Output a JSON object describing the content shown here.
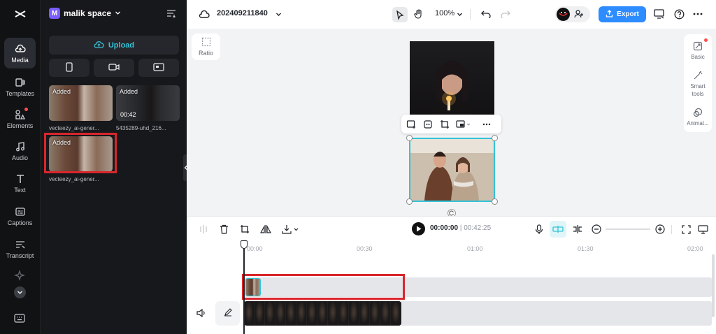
{
  "rail": {
    "items": [
      {
        "label": "Media",
        "icon": "cloud-media-icon",
        "active": true
      },
      {
        "label": "Templates",
        "icon": "templates-icon"
      },
      {
        "label": "Elements",
        "icon": "elements-icon",
        "dot": true
      },
      {
        "label": "Audio",
        "icon": "music-note-icon"
      },
      {
        "label": "Text",
        "icon": "text-t-icon"
      },
      {
        "label": "Captions",
        "icon": "captions-icon"
      },
      {
        "label": "Transcript",
        "icon": "transcript-icon"
      }
    ]
  },
  "panel": {
    "workspace_initial": "M",
    "workspace_name": "malik space",
    "upload_label": "Upload",
    "media": [
      {
        "badge": "Added",
        "caption": "vecteezy_ai-gener...",
        "duration": ""
      },
      {
        "badge": "Added",
        "caption": "5435289-uhd_216...",
        "duration": "00:42"
      },
      {
        "badge": "Added",
        "caption": "vecteezy_ai-gener...",
        "duration": ""
      }
    ]
  },
  "topbar": {
    "project_title": "202409211840",
    "zoom": "100%",
    "export_label": "Export"
  },
  "stage": {
    "ratio_label": "Ratio"
  },
  "props": {
    "basic": "Basic",
    "smart_tools_1": "Smart",
    "smart_tools_2": "tools",
    "animation": "Animat..."
  },
  "timeline": {
    "current": "00:00:00",
    "separator": "|",
    "total": "00:42:25",
    "ruler": [
      "00:00",
      "00:30",
      "01:00",
      "01:30",
      "02:00"
    ]
  },
  "colors": {
    "accent": "#34c3d8",
    "export": "#2d8cff",
    "highlight": "#d9262c",
    "workspace": "#7b5cff"
  }
}
